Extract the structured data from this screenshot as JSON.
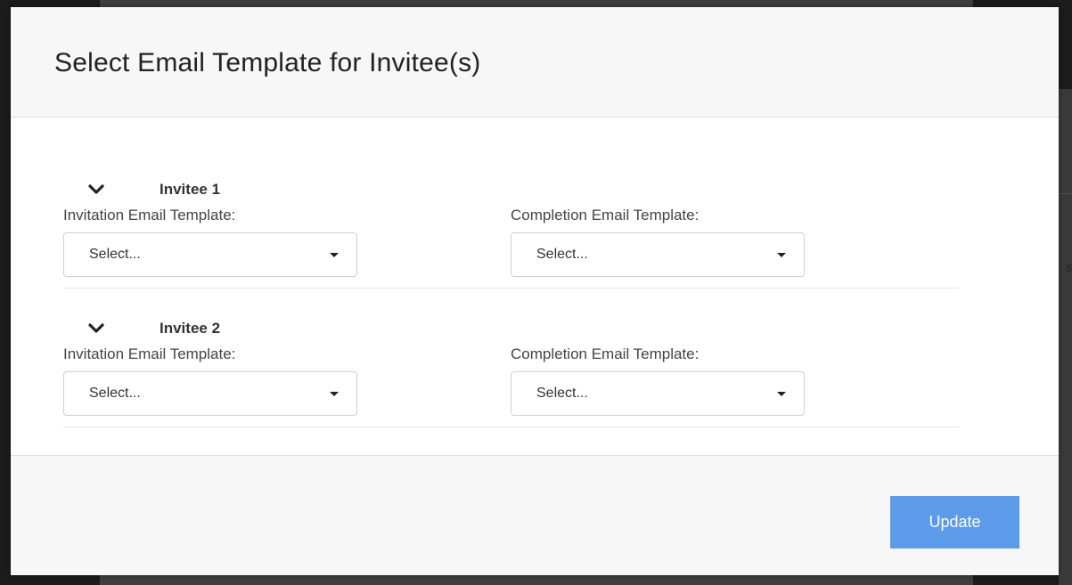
{
  "modal": {
    "title": "Select Email Template for Invitee(s)"
  },
  "invitees": [
    {
      "title": "Invitee 1",
      "invitation_label": "Invitation Email Template:",
      "invitation_value": "Select...",
      "completion_label": "Completion Email Template:",
      "completion_value": "Select..."
    },
    {
      "title": "Invitee 2",
      "invitation_label": "Invitation Email Template:",
      "invitation_value": "Select...",
      "completion_label": "Completion Email Template:",
      "completion_value": "Select..."
    }
  ],
  "footer": {
    "update_label": "Update"
  },
  "background": {
    "partial_char": "s"
  },
  "colors": {
    "primary_button": "#5b9bea",
    "header_bg": "#f7f7f7",
    "overlay": "#3f3f3f"
  },
  "icons": {
    "section_toggle": "chevron-down-icon",
    "select_toggle": "caret-down-icon"
  }
}
